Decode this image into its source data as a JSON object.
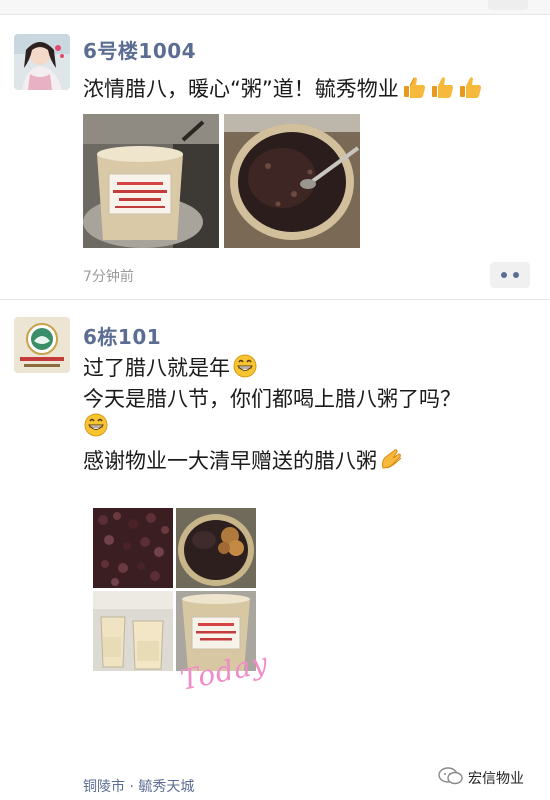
{
  "posts": [
    {
      "nickname": "6号楼1004",
      "lines": [
        "浓情腊八，暖心“粥”道！毓秀物业"
      ],
      "time": "7分钟前",
      "icons": [
        "thumbs-up-icon",
        "thumbs-up-icon",
        "thumbs-up-icon"
      ]
    },
    {
      "nickname": "6栋101",
      "lines": [
        "过了腊八就是年",
        "今天是腊八节，你们都喝上腊八粥了吗？",
        "",
        "感谢物业一大清早赠送的腊八粥"
      ],
      "location": "铜陵市 · 毓秀天城",
      "photo_overlay": "Today",
      "icons": [
        "grin-emoji-icon",
        "grin-emoji-icon",
        "clap-hands-icon"
      ]
    }
  ],
  "watermark": {
    "text": "宏信物业"
  },
  "colors": {
    "nickname": "#5c6d93",
    "time": "#9b9b9b",
    "background": "#ffffff"
  }
}
